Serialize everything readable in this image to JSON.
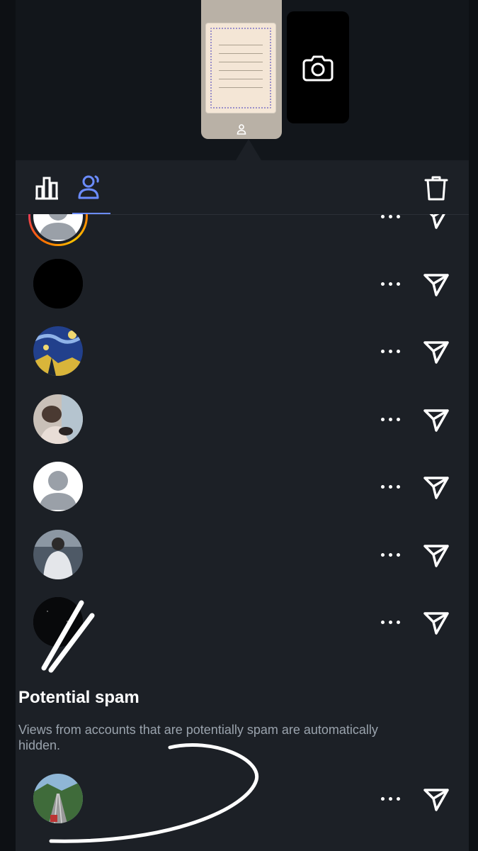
{
  "story": {
    "thumbnail_kind": "handwritten-page-photo",
    "camera_icon": "camera-icon",
    "user_icon": "person-icon"
  },
  "tabs": [
    {
      "icon": "bar-chart-icon",
      "selected": false
    },
    {
      "icon": "viewers-icon",
      "selected": true
    }
  ],
  "delete_icon": "trash-icon",
  "viewers": [
    {
      "avatar": "default-person",
      "story_ring": true
    },
    {
      "avatar": "black"
    },
    {
      "avatar": "starry-night-painting"
    },
    {
      "avatar": "photo-person-with-cat"
    },
    {
      "avatar": "default-person"
    },
    {
      "avatar": "photo-person-back-view"
    },
    {
      "avatar": "dark-sky"
    }
  ],
  "spam": {
    "title": "Potential spam",
    "description": "Views from accounts that are potentially spam are automatically hidden.",
    "viewers": [
      {
        "avatar": "photo-railway-tracks"
      }
    ]
  },
  "row_actions": {
    "more_icon": "more-horizontal-icon",
    "send_icon": "send-icon"
  },
  "colors": {
    "accent": "#6b8cff",
    "sheet_background": "#1c2026",
    "page_background": "#0d1014",
    "muted_text": "#9aa3ad",
    "story_ring_start": "#ff2fa0",
    "story_ring_end": "#ffc400"
  }
}
